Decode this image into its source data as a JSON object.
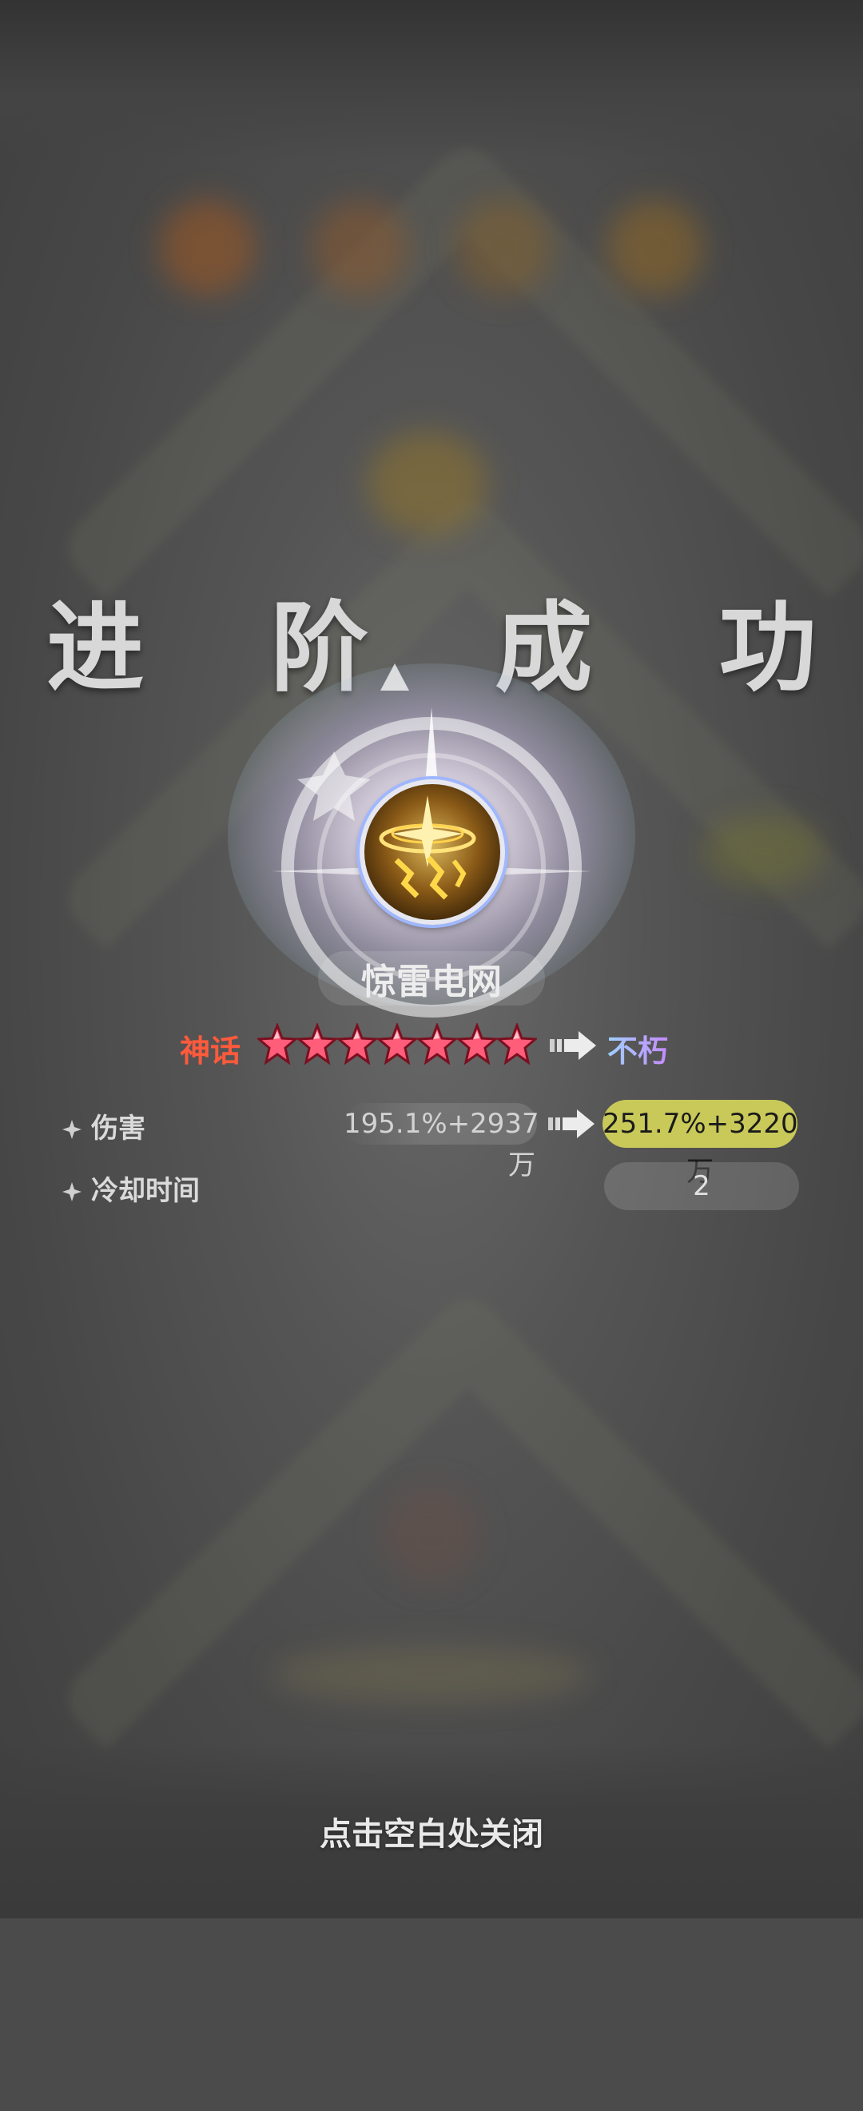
{
  "title": "进 阶 成 功",
  "skill": {
    "name": "惊雷电网",
    "icon": "lightning-net-icon"
  },
  "rank": {
    "from": "神话",
    "stars": 7,
    "to": "不朽"
  },
  "stats": [
    {
      "label": "伤害",
      "old": "195.1%+2937万",
      "new": "251.7%+3220万"
    },
    {
      "label": "冷却时间",
      "value": "2"
    }
  ],
  "close_hint": "点击空白处关闭",
  "colors": {
    "rank_from": "#ff5a3c",
    "rank_to_gradient": [
      "#9fd0ff",
      "#c58bff"
    ],
    "new_value_bg": "#c9c95a",
    "star_fill": "#ff5d7a"
  }
}
